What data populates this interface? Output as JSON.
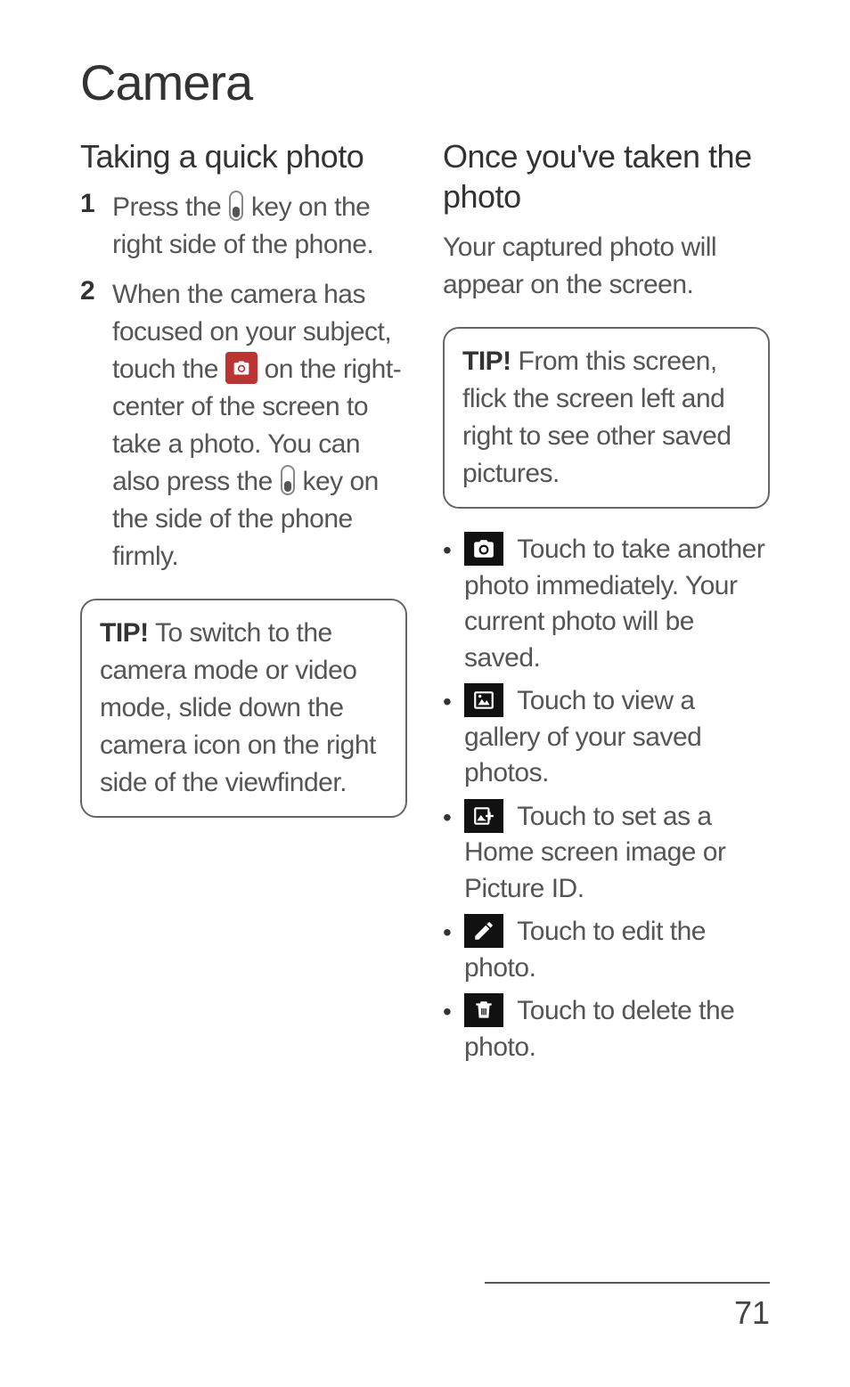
{
  "title": "Camera",
  "pageNumber": "71",
  "left": {
    "heading": "Taking a quick photo",
    "steps": [
      {
        "num": "1",
        "pre": "Press the ",
        "post": " key on the right side of the phone."
      },
      {
        "num": "2",
        "pre": "When the camera has focused on your subject, touch the ",
        "mid": " on  the right-center of the screen to take a photo. You can also press the ",
        "post": " key on the side of the phone firmly."
      }
    ],
    "tip": {
      "label": "TIP!",
      "text": " To switch to the camera mode or video mode, slide down the camera icon on the right side of the viewfinder."
    }
  },
  "right": {
    "heading": "Once you've taken the photo",
    "intro": "Your captured photo will appear on the screen.",
    "tip": {
      "label": "TIP!",
      "text": " From this screen, flick the screen left and right to see other saved pictures."
    },
    "bullets": [
      {
        "icon": "camera-icon",
        "text": "  Touch to take another photo immediately. Your current photo will be saved."
      },
      {
        "icon": "gallery-icon",
        "text": "  Touch to view a gallery of your saved photos."
      },
      {
        "icon": "set-as-icon",
        "text": "  Touch to set as a Home screen image or Picture ID."
      },
      {
        "icon": "edit-icon",
        "text": "  Touch to edit the photo."
      },
      {
        "icon": "delete-icon",
        "text": "  Touch to delete the photo."
      }
    ]
  }
}
